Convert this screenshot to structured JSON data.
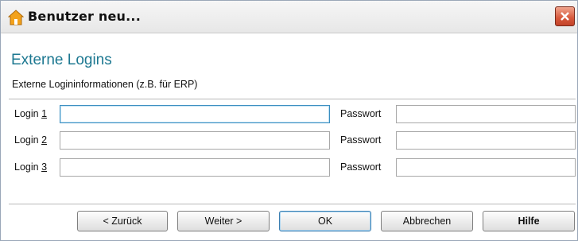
{
  "window": {
    "title": "Benutzer neu...",
    "icon": "house-icon"
  },
  "section": {
    "title": "Externe Logins",
    "subtitle": "Externe Logininformationen (z.B. für ERP)"
  },
  "rows": [
    {
      "login_label_prefix": "Login ",
      "login_label_key": "1",
      "login_value": "",
      "password_label": "Passwort",
      "password_value": ""
    },
    {
      "login_label_prefix": "Login ",
      "login_label_key": "2",
      "login_value": "",
      "password_label": "Passwort",
      "password_value": ""
    },
    {
      "login_label_prefix": "Login ",
      "login_label_key": "3",
      "login_value": "",
      "password_label": "Passwort",
      "password_value": ""
    }
  ],
  "buttons": {
    "back": "< Zurück",
    "next": "Weiter >",
    "ok": "OK",
    "cancel": "Abbrechen",
    "help": "Hilfe"
  },
  "colors": {
    "section_title": "#1d7891",
    "close_button": "#d7583b",
    "focus_border": "#3c8ec0"
  }
}
